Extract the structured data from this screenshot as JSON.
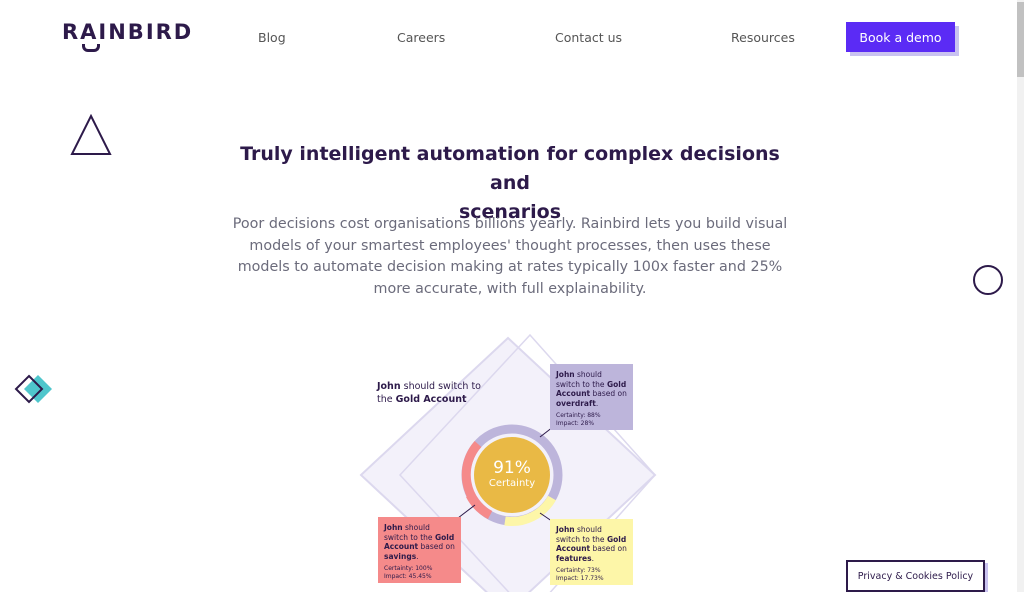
{
  "brand": {
    "name": "RAINBIRD"
  },
  "nav": {
    "items": [
      "Blog",
      "Careers",
      "Contact us",
      "Resources"
    ],
    "cta": "Book a demo"
  },
  "hero": {
    "title_line1": "Truly intelligent automation for complex decisions and",
    "title_line2": "scenarios",
    "lead": "Poor decisions cost organisations billions yearly. Rainbird lets you build visual models of your smartest employees' thought processes, then uses these models to automate decision making at rates typically 100x faster and 25% more accurate, with full explainability."
  },
  "illustration": {
    "headline_name": "John",
    "headline_mid": " should switch to the ",
    "headline_account": "Gold Account",
    "certainty_value": "91%",
    "certainty_label": "Certainty",
    "cards": [
      {
        "name": "John",
        "text": " should switch to the ",
        "account": "Gold Account",
        "based": " based on ",
        "reason": "overdraft",
        "certainty": "Certainty: 88%",
        "impact": "Impact: 28%",
        "color": "#bdb5db"
      },
      {
        "name": "John",
        "text": " should switch to the ",
        "account": "Gold Account",
        "based": " based on ",
        "reason": "savings",
        "certainty": "Certainty: 100%",
        "impact": "Impact: 45.45%",
        "color": "#f58a8a"
      },
      {
        "name": "John",
        "text": " should switch to the ",
        "account": "Gold Account",
        "based": " based on ",
        "reason": "features",
        "certainty": "Certainty: 73%",
        "impact": "Impact: 17.73%",
        "color": "#fdf6a8"
      }
    ]
  },
  "cookie": {
    "label": "Privacy & Cookies Policy"
  },
  "colors": {
    "primary": "#5b2bf5",
    "ink": "#2d1a4a",
    "gold": "#e9b945"
  }
}
